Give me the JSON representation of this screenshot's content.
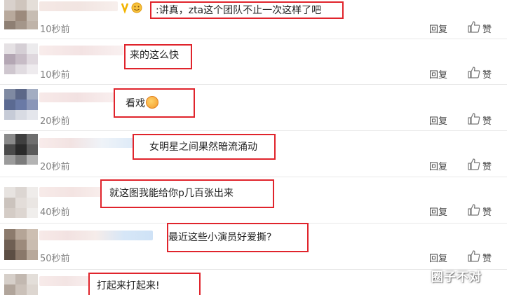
{
  "comments": [
    {
      "text": "讲真，zta这个团队不止一次这样了吧",
      "time": "10秒前",
      "reply": "回复",
      "like": "赞"
    },
    {
      "text": "来的这么快",
      "time": "10秒前",
      "reply": "回复",
      "like": "赞"
    },
    {
      "text": "看戏",
      "time": "20秒前",
      "reply": "回复",
      "like": "赞"
    },
    {
      "text": "女明星之间果然暗流涌动",
      "time": "20秒前",
      "reply": "回复",
      "like": "赞"
    },
    {
      "text": "就这图我能给你p几百张出来",
      "time": "40秒前",
      "reply": "回复",
      "like": "赞"
    },
    {
      "text": "最近这些小演员好爱撕?",
      "time": "50秒前",
      "reply": "回复",
      "like": "赞"
    },
    {
      "text": "打起来打起来!",
      "time": "",
      "reply": "",
      "like": ""
    }
  ],
  "content_prefix": ":",
  "watermark": "圈子不对",
  "colors": {
    "highlight_border": "#e0242c",
    "muted_text": "#808080"
  }
}
